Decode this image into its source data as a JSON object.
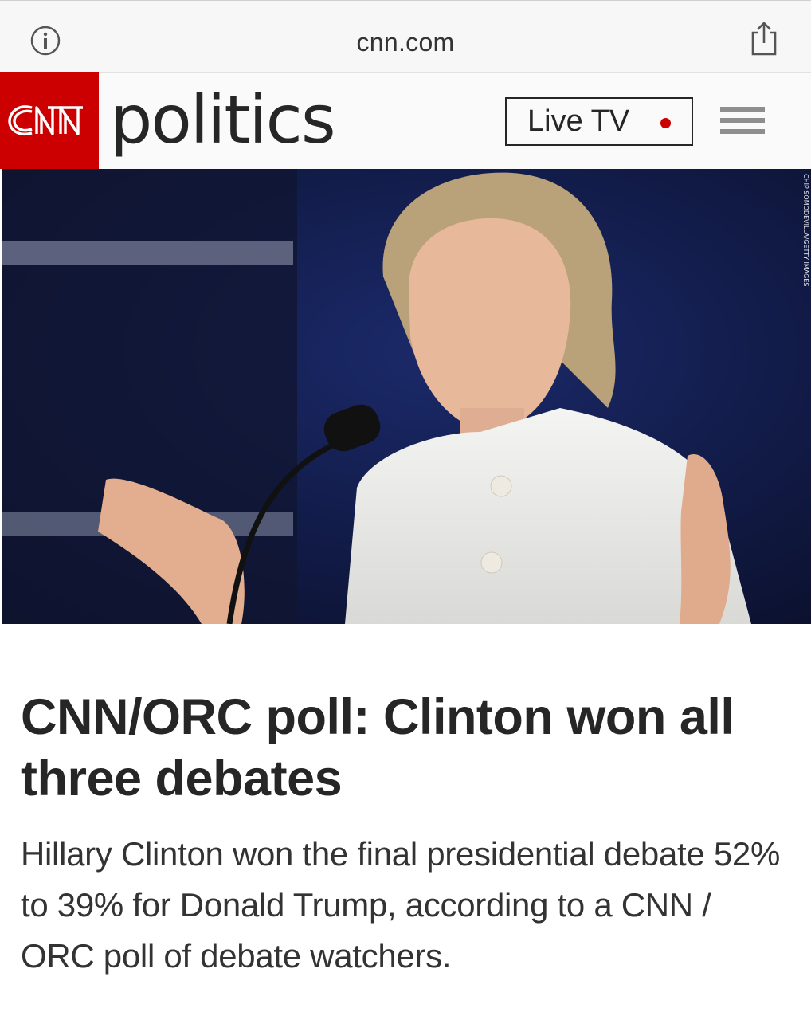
{
  "browser": {
    "url": "cnn.com",
    "info_icon": "info-icon",
    "share_icon": "share-icon"
  },
  "header": {
    "logo_text": "CNN",
    "section": "politics",
    "live_tv_label": "Live TV",
    "menu_icon": "hamburger-menu-icon",
    "brand_color": "#cc0000"
  },
  "hero": {
    "photo_credit": "CHIP SOMODEVILLA/GETTY IMAGES"
  },
  "article": {
    "headline": "CNN/ORC poll: Clinton won all three debates",
    "summary": "Hillary Clinton won the final presidential debate 52% to 39% for Donald Trump, according to a CNN / ORC poll of debate watchers."
  }
}
